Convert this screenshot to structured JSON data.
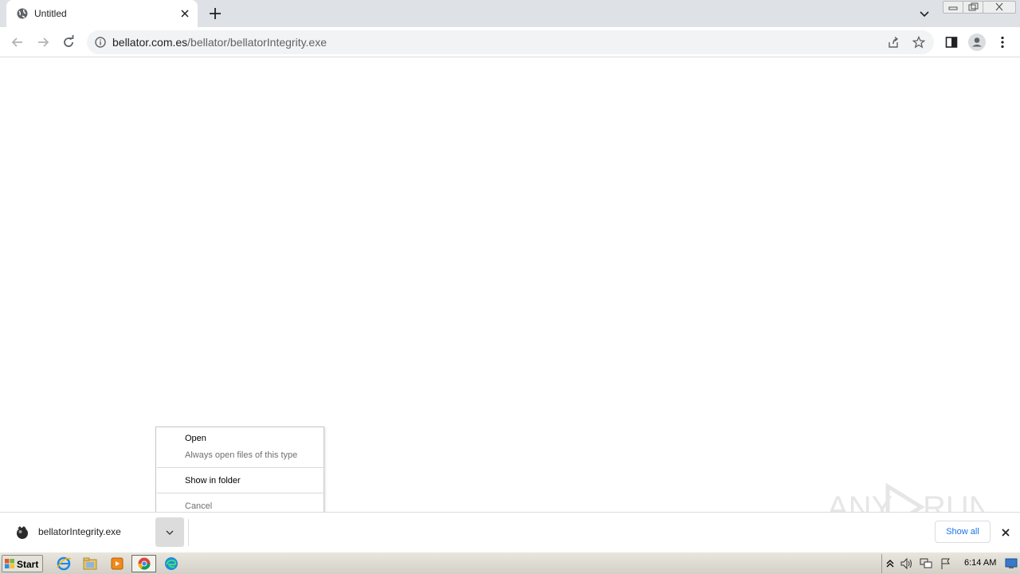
{
  "browser": {
    "tab": {
      "title": "Untitled"
    },
    "address": {
      "host": "bellator.com.es",
      "path": "/bellator/bellatorIntegrity.exe"
    }
  },
  "context_menu": {
    "items": [
      {
        "label": "Open",
        "enabled": true
      },
      {
        "label": "Always open files of this type",
        "enabled": false
      },
      {
        "label": "Show in folder",
        "enabled": true
      },
      {
        "label": "Cancel",
        "enabled": false
      }
    ]
  },
  "download_shelf": {
    "file_name": "bellatorIntegrity.exe",
    "show_all_label": "Show all"
  },
  "watermark": {
    "text": "ANY RUN"
  },
  "taskbar": {
    "start_label": "Start",
    "pinned": [
      "internet-explorer-icon",
      "folder-icon",
      "media-player-icon",
      "chrome-icon",
      "edge-icon"
    ],
    "clock": "6:14 AM"
  },
  "colors": {
    "accent": "#1a73e8",
    "tabstrip": "#dee1e6",
    "omnibox": "#f1f3f4"
  }
}
